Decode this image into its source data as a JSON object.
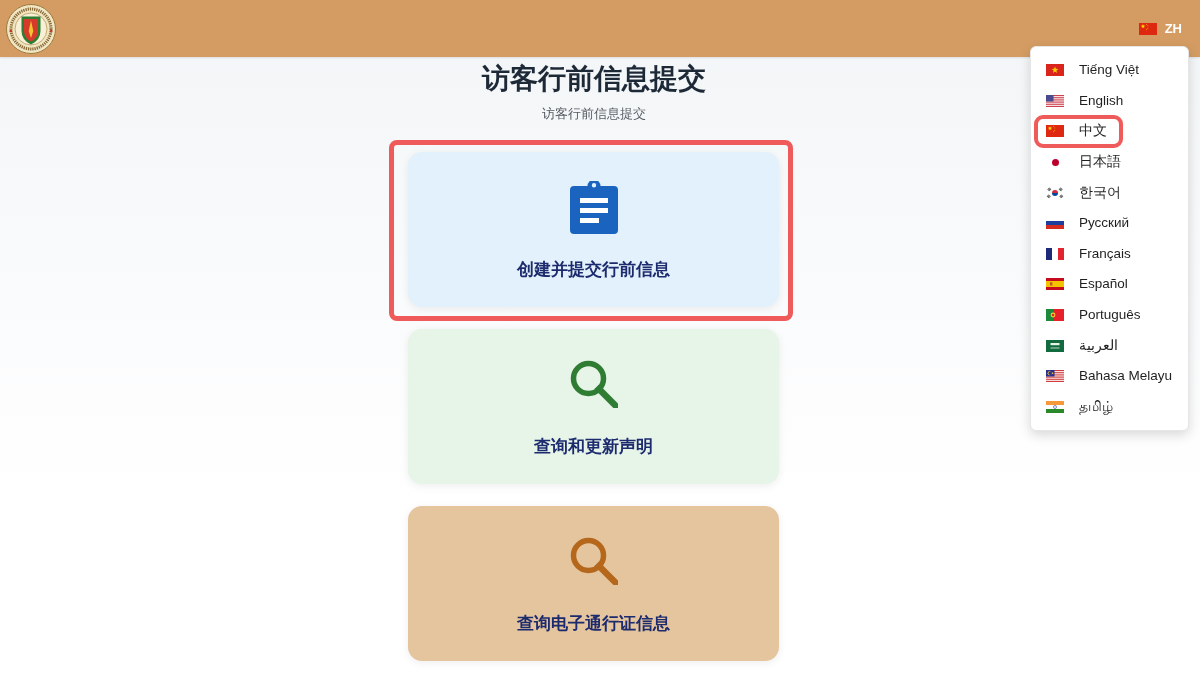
{
  "header": {
    "language_button": {
      "kind": "china",
      "label": "ZH"
    }
  },
  "language_menu": {
    "items": [
      {
        "kind": "vietnam",
        "label": "Tiếng Việt",
        "highlighted": false
      },
      {
        "kind": "usa",
        "label": "English",
        "highlighted": false
      },
      {
        "kind": "china",
        "label": "中文",
        "highlighted": true
      },
      {
        "kind": "japan",
        "label": "日本語",
        "highlighted": false
      },
      {
        "kind": "korea",
        "label": "한국어",
        "highlighted": false
      },
      {
        "kind": "russia",
        "label": "Русский",
        "highlighted": false
      },
      {
        "kind": "france",
        "label": "Français",
        "highlighted": false
      },
      {
        "kind": "spain",
        "label": "Español",
        "highlighted": false
      },
      {
        "kind": "portugal",
        "label": "Português",
        "highlighted": false
      },
      {
        "kind": "saudi",
        "label": "العربية",
        "highlighted": false
      },
      {
        "kind": "malaysia",
        "label": "Bahasa Melayu",
        "highlighted": false
      },
      {
        "kind": "india",
        "label": "தமிழ்",
        "highlighted": false
      }
    ]
  },
  "page": {
    "title": "访客行前信息提交",
    "subtitle": "访客行前信息提交"
  },
  "cards": [
    {
      "label": "创建并提交行前信息",
      "color": "#e2f1fb",
      "highlighted": true,
      "icon": {
        "kind": "clipboard",
        "color": "#1a64c0"
      }
    },
    {
      "label": "查询和更新声明",
      "color": "#e7f4e8",
      "highlighted": false,
      "icon": {
        "kind": "search",
        "color": "#2e7d32"
      }
    },
    {
      "label": "查询电子通行证信息",
      "color": "#e5c59d",
      "highlighted": false,
      "icon": {
        "kind": "search",
        "color": "#b5671c"
      }
    }
  ]
}
